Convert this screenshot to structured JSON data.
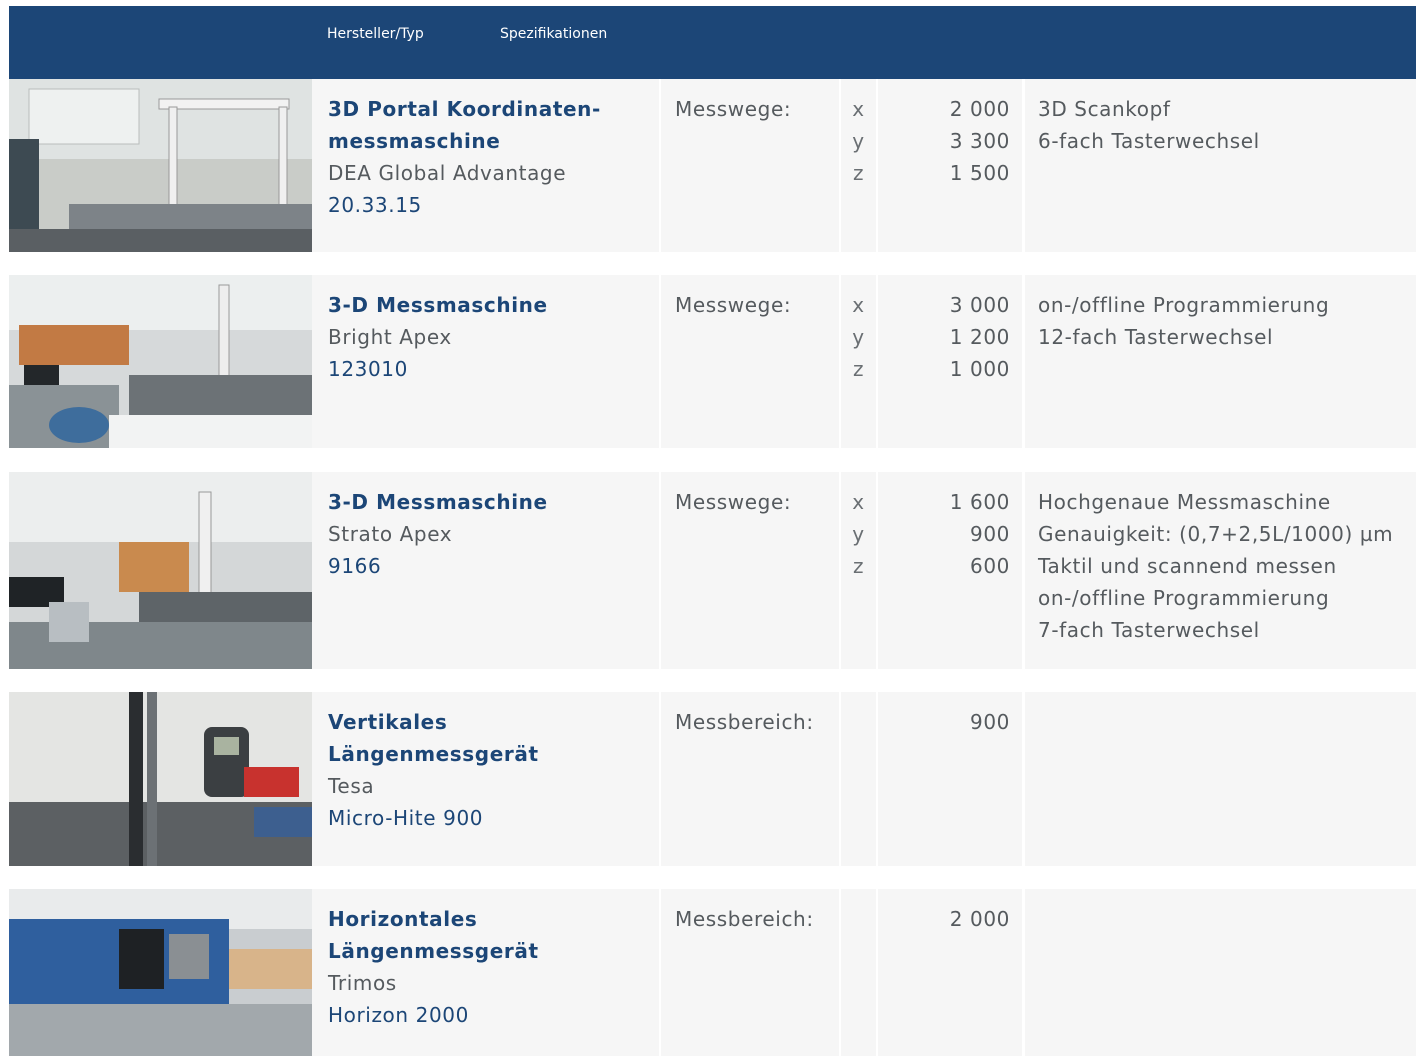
{
  "header": {
    "col_manufacturer": "Hersteller/Typ",
    "col_specs": "Spezifikationen",
    "bg_color": "#1c4677"
  },
  "rows": [
    {
      "title_lines": [
        "3D Portal Koordinaten-",
        "messmaschine"
      ],
      "maker": "DEA Global Advantage",
      "type": "20.33.15",
      "spec_label": "Messwege:",
      "axes": [
        "x",
        "y",
        "z"
      ],
      "values": [
        "2 000",
        "3 300",
        "1 500"
      ],
      "notes": [
        "3D Scankopf",
        "6-fach Tasterwechsel"
      ]
    },
    {
      "title_lines": [
        "3-D Messmaschine"
      ],
      "maker": "Bright Apex",
      "type": "123010",
      "spec_label": "Messwege:",
      "axes": [
        "x",
        "y",
        "z"
      ],
      "values": [
        "3 000",
        "1 200",
        "1 000"
      ],
      "notes": [
        "on-/offline Programmierung",
        "12-fach Tasterwechsel"
      ]
    },
    {
      "title_lines": [
        "3-D Messmaschine"
      ],
      "maker": "Strato Apex",
      "type": "9166",
      "spec_label": "Messwege:",
      "axes": [
        "x",
        "y",
        "z"
      ],
      "values": [
        "1 600",
        "900",
        "600"
      ],
      "notes": [
        "Hochgenaue Messmaschine",
        "Genauigkeit: (0,7+2,5L/1000) µm",
        "Taktil und scannend messen",
        "on-/offline Programmierung",
        "7-fach Tasterwechsel"
      ]
    },
    {
      "title_lines": [
        "Vertikales",
        "Längenmessgerät"
      ],
      "maker": "Tesa",
      "type": "Micro-Hite 900",
      "spec_label": "Messbereich:",
      "axes": [],
      "values": [
        "900"
      ],
      "notes": []
    },
    {
      "title_lines": [
        "Horizontales",
        "Längenmessgerät"
      ],
      "maker": "Trimos",
      "type": "Horizon 2000",
      "spec_label": "Messbereich:",
      "axes": [],
      "values": [
        "2 000"
      ],
      "notes": []
    }
  ]
}
